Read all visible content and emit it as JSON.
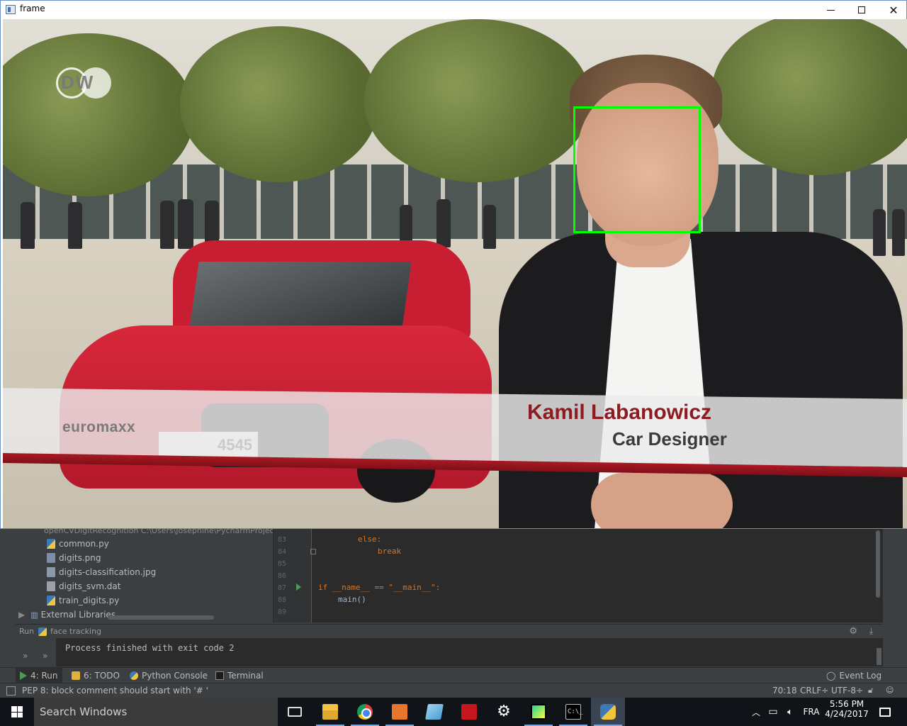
{
  "frame_window": {
    "title": "frame",
    "overlay": {
      "channel_logo": "DW",
      "show_label": "euromaxx",
      "name": "Kamil Labanowicz",
      "role": "Car Designer",
      "plate_text": "4545"
    },
    "face_box_color": "#00ff00"
  },
  "ide": {
    "project_tree": {
      "root_label": "openCVDigitRecognition  C:\\Users\\Josephine\\PycharmProjects",
      "items": [
        {
          "label": "common.py",
          "icon": "python-file-icon"
        },
        {
          "label": "digits.png",
          "icon": "image-file-icon"
        },
        {
          "label": "digits-classification.jpg",
          "icon": "image-file-icon"
        },
        {
          "label": "digits_svm.dat",
          "icon": "data-file-icon"
        },
        {
          "label": "train_digits.py",
          "icon": "python-file-icon"
        }
      ],
      "external_libraries": "External Libraries"
    },
    "editor": {
      "lines": [
        {
          "num": "83",
          "text": "else:"
        },
        {
          "num": "84",
          "text": "break"
        },
        {
          "num": "85",
          "text": ""
        },
        {
          "num": "86",
          "text": ""
        },
        {
          "num": "87",
          "text": "if __name__ == \"__main__\":"
        },
        {
          "num": "88",
          "text": "main()"
        },
        {
          "num": "89",
          "text": ""
        }
      ]
    },
    "run_panel": {
      "label": "Run",
      "config": "face tracking",
      "output": "Process finished with exit code 2"
    },
    "tool_tabs": {
      "run": "4: Run",
      "todo": "6: TODO",
      "python_console": "Python Console",
      "terminal": "Terminal",
      "event_log": "Event Log"
    },
    "status_bar": {
      "message": "PEP 8: block comment should start with '# '",
      "position": "70:18",
      "line_separator": "CRLF÷",
      "encoding": "UTF-8÷"
    }
  },
  "taskbar": {
    "search_placeholder": "Search Windows",
    "language": "FRA",
    "time": "5:56 PM",
    "date": "4/24/2017"
  }
}
